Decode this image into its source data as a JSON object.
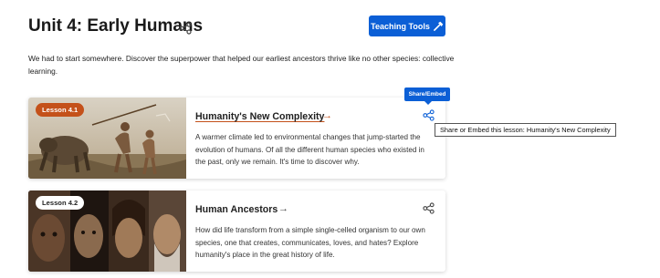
{
  "header": {
    "title": "Unit 4: Early Humans",
    "teaching_tools_label": "Teaching Tools"
  },
  "intro": "We had to start somewhere. Discover the superpower that helped our earliest ancestors thrive like no other species: collective learning.",
  "share_embed_label": "Share/Embed",
  "tooltip": "Share or Embed this lesson: Humanity's New Complexity",
  "lessons": [
    {
      "badge": "Lesson 4.1",
      "title": "Humanity's New Complexity",
      "arrow": "→",
      "description": "A warmer climate led to environmental changes that jump-started the evolution of humans. Of all the different human species who existed in the past, only we remain. It's time to discover why."
    },
    {
      "badge": "Lesson 4.2",
      "title": "Human Ancestors",
      "arrow": "→",
      "description": "How did life transform from a simple single-celled organism to our own species, one that creates, communicates, loves, and hates? Explore humanity's place in the great history of life."
    }
  ],
  "colors": {
    "accent_blue": "#0b5fd6",
    "accent_orange": "#c4511a"
  },
  "icons": {
    "share": "share-icon",
    "teaching_tools": "hammer-icon",
    "arrow": "arrow-right-icon"
  }
}
